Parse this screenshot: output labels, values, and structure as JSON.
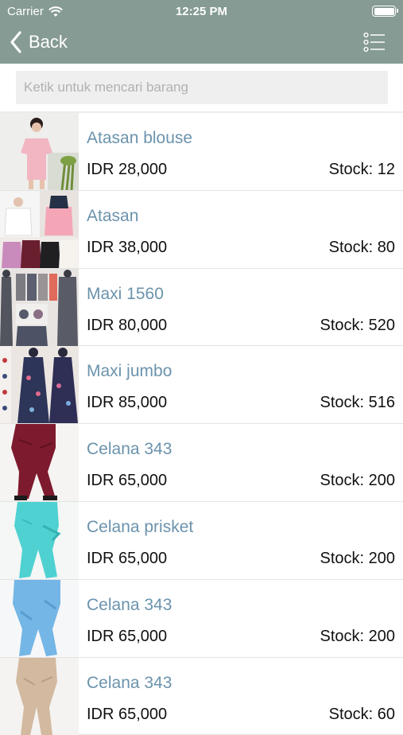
{
  "status_bar": {
    "carrier": "Carrier",
    "time": "12:25 PM"
  },
  "nav": {
    "back_label": "Back",
    "right_icon": "list-menu-icon"
  },
  "search": {
    "placeholder": "Ketik untuk mencari barang"
  },
  "colors": {
    "header": "#869b93",
    "item_name": "#6b93ac"
  },
  "products": [
    {
      "name": "Atasan blouse",
      "price": "IDR 28,000",
      "stock": "Stock: 12",
      "image": "pink-blouse-photo"
    },
    {
      "name": "Atasan",
      "price": "IDR 38,000",
      "stock": "Stock: 80",
      "image": "tops-collage-photo"
    },
    {
      "name": "Maxi 1560",
      "price": "IDR 80,000",
      "stock": "Stock: 520",
      "image": "maxi-dress-collage-photo"
    },
    {
      "name": "Maxi jumbo",
      "price": "IDR 85,000",
      "stock": "Stock: 516",
      "image": "floral-maxi-photo"
    },
    {
      "name": "Celana 343",
      "price": "IDR 65,000",
      "stock": "Stock: 200",
      "image": "maroon-pants-photo"
    },
    {
      "name": "Celana prisket",
      "price": "IDR 65,000",
      "stock": "Stock: 200",
      "image": "turquoise-pants-photo"
    },
    {
      "name": "Celana 343",
      "price": "IDR 65,000",
      "stock": "Stock: 200",
      "image": "light-blue-pants-photo"
    },
    {
      "name": "Celana 343",
      "price": "IDR 65,000",
      "stock": "Stock: 60",
      "image": "beige-pants-photo"
    }
  ]
}
